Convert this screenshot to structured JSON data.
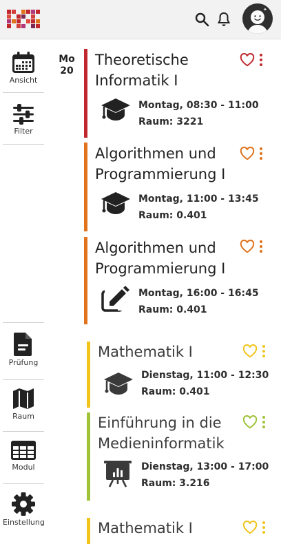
{
  "app": {
    "logo_icon": "university-logo-icon",
    "avatar_icon": "smiley-avatar-icon"
  },
  "topbar": {
    "search_icon": "search-icon",
    "bell_icon": "bell-icon"
  },
  "sidebar": {
    "items": [
      {
        "label": "Ansicht",
        "icon": "calendar-icon"
      },
      {
        "label": "Filter",
        "icon": "sliders-icon"
      },
      {
        "label": "Prüfung",
        "icon": "document-icon"
      },
      {
        "label": "Raum",
        "icon": "map-icon"
      },
      {
        "label": "Modul",
        "icon": "table-icon"
      },
      {
        "label": "Einstellung",
        "icon": "gear-icon"
      }
    ]
  },
  "date": {
    "day": "Mo",
    "num": "20"
  },
  "events": [
    {
      "title": "Theoretische Informatik I",
      "time": "Montag, 08:30 - 11:00",
      "room": "Raum: 3221",
      "type_icon": "graduation-cap-icon",
      "color": "#c0282d"
    },
    {
      "title": "Algorithmen und Programmierung I",
      "time": "Montag, 11:00 - 13:45",
      "room": "Raum: 0.401",
      "type_icon": "graduation-cap-icon",
      "color": "#e0731c"
    },
    {
      "title": "Algorithmen und Programmierung I",
      "time": "Montag, 16:00 - 16:45",
      "room": "Raum: 0.401",
      "type_icon": "edit-icon",
      "color": "#e0731c"
    },
    {
      "title": "Mathematik I",
      "time": "Dienstag, 11:00 - 12:30",
      "room": "Raum: 0.401",
      "type_icon": "graduation-cap-icon",
      "color": "#f0c419"
    },
    {
      "title": "Einführung in die Medieninformatik",
      "time": "Dienstag, 13:00 - 17:00",
      "room": "Raum: 3.216",
      "type_icon": "presentation-icon",
      "color": "#9fc238"
    },
    {
      "title": "Mathematik I",
      "time": "",
      "room": "",
      "type_icon": "",
      "color": "#f0c419"
    }
  ]
}
